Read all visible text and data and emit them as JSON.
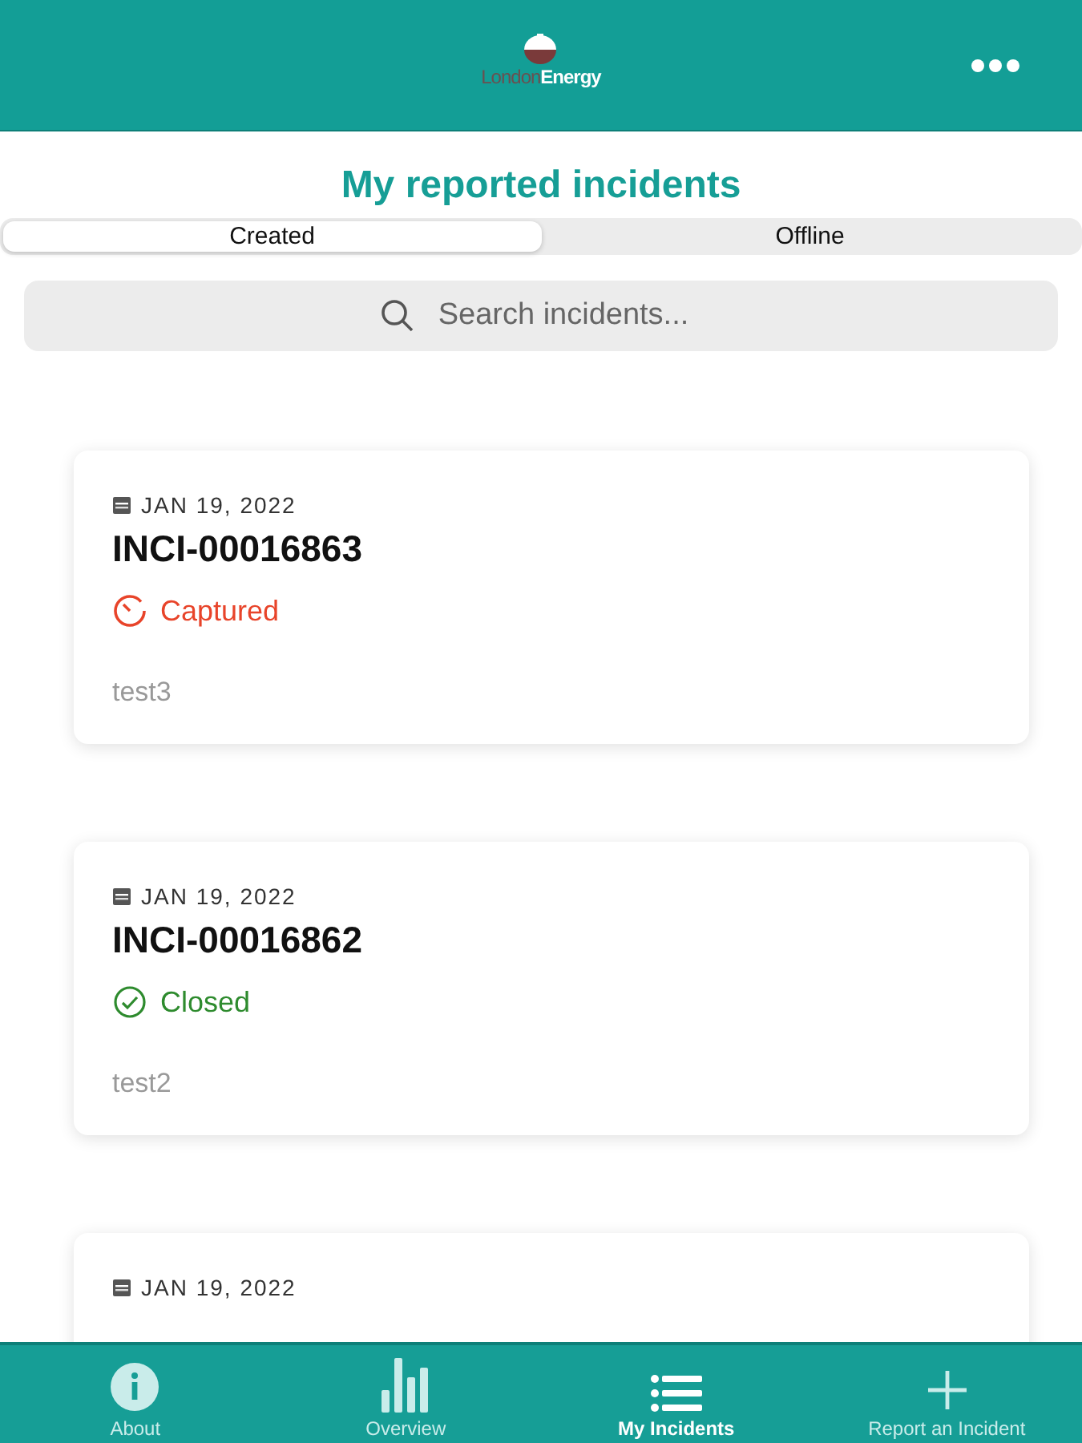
{
  "header": {
    "logo": {
      "word_1": "London",
      "word_2": "Energy"
    }
  },
  "title": "My reported incidents",
  "segments": [
    {
      "label": "Created",
      "selected": true
    },
    {
      "label": "Offline",
      "selected": false
    }
  ],
  "search": {
    "placeholder": "Search incidents..."
  },
  "incidents": [
    {
      "date": "JAN 19, 2022",
      "number": "INCI-00016863",
      "status": {
        "kind": "captured",
        "label": "Captured"
      },
      "description": "test3"
    },
    {
      "date": "JAN 19, 2022",
      "number": "INCI-00016862",
      "status": {
        "kind": "closed",
        "label": "Closed"
      },
      "description": "test2"
    },
    {
      "date": "JAN 19, 2022"
    }
  ],
  "tab_bar": [
    {
      "kind": "info",
      "label": "About",
      "selected": false
    },
    {
      "kind": "chart",
      "label": "Overview",
      "selected": false
    },
    {
      "kind": "list",
      "label": "My Incidents",
      "selected": true
    },
    {
      "kind": "plus",
      "label": "Report an Incident",
      "selected": false
    }
  ]
}
